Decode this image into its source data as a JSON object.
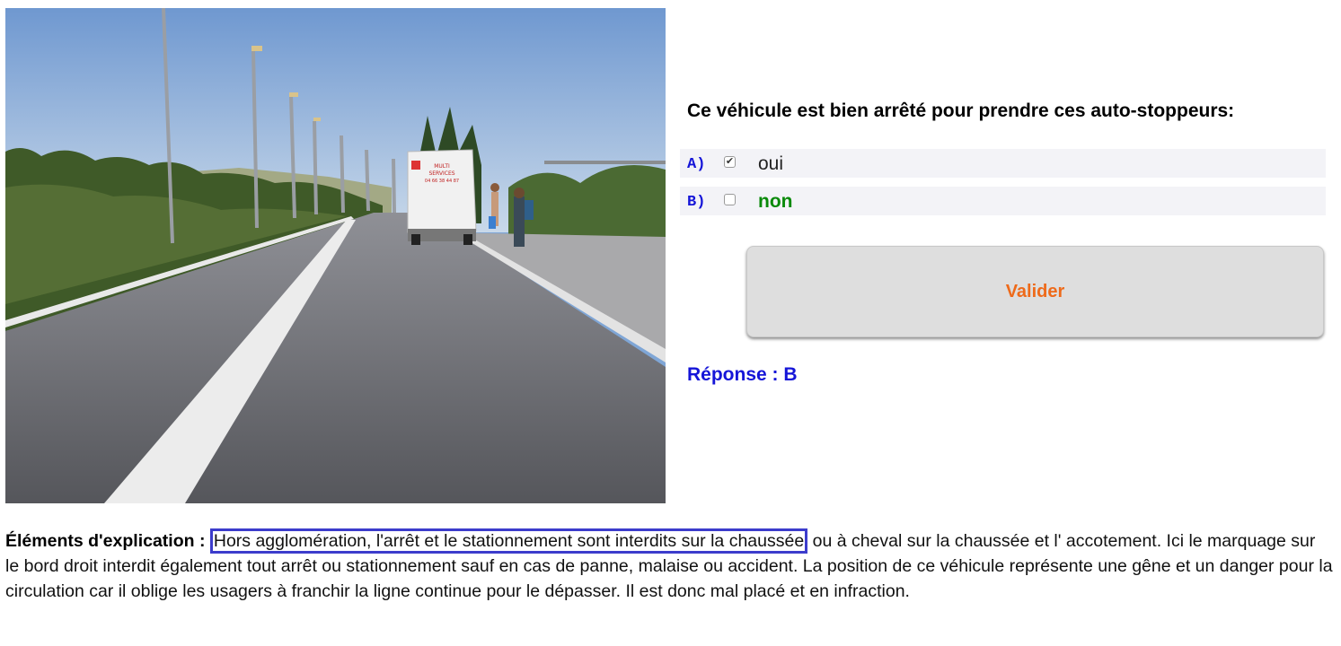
{
  "photo": {
    "van_sign_lines": [
      "MULTI",
      "SERVICES",
      "04 66 38 44 87"
    ]
  },
  "question": {
    "text": "Ce véhicule est bien arrêté pour prendre ces auto-stoppeurs:"
  },
  "answers": [
    {
      "letter": "A)",
      "label": "oui",
      "checked": true
    },
    {
      "letter": "B)",
      "label": "non",
      "checked": false
    }
  ],
  "submit": {
    "label": "Valider"
  },
  "result": {
    "text": "Réponse : B"
  },
  "explanation": {
    "lead": "Éléments d'explication :",
    "highlight": "Hors agglomération, l'arrêt et le stationnement sont interdits sur la chaussée",
    "rest": "ou à cheval sur la chaussée et l' accotement. Ici le marquage sur le bord droit interdit également tout arrêt ou stationnement sauf en cas de panne, malaise ou accident. La position de ce véhicule représente une gêne et un danger pour la circulation car il oblige les usagers à franchir la ligne continue pour le dépasser. Il est donc mal placé et en infraction."
  },
  "colors": {
    "letter": "#1515d8",
    "correct_answer": "#0a8a0a",
    "submit_text": "#ee6a1a",
    "result": "#1515d8",
    "highlight_border": "#3c3ccc"
  }
}
